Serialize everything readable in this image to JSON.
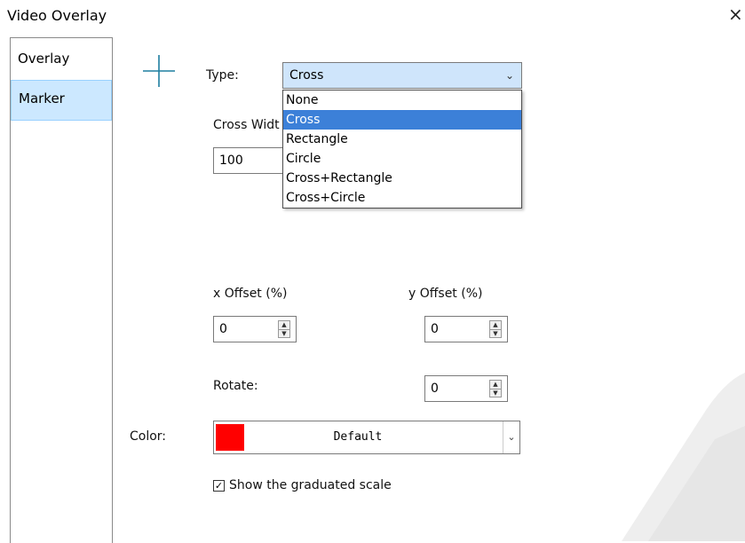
{
  "window": {
    "title": "Video Overlay",
    "close_label": "×"
  },
  "nav": {
    "items": [
      {
        "label": "Overlay"
      },
      {
        "label": "Marker"
      }
    ]
  },
  "marker": {
    "type_label": "Type:",
    "type_value": "Cross",
    "type_options": [
      "None",
      "Cross",
      "Rectangle",
      "Circle",
      "Cross+Rectangle",
      "Cross+Circle"
    ],
    "cross_width_label": "Cross Widt",
    "cross_width_value": "100",
    "x_offset_label": "x Offset (%)",
    "x_offset_value": "0",
    "y_offset_label": "y Offset (%)",
    "y_offset_value": "0",
    "rotate_label": "Rotate:",
    "rotate_value": "0",
    "color_label": "Color:",
    "color_value": "Default",
    "color_swatch": "#ff0000",
    "show_scale_label": "Show the graduated scale",
    "show_scale_checked": true
  },
  "colors": {
    "selection_bg": "#cce8ff",
    "dropdown_highlight": "#3c80d8",
    "icon": "#1e7fa0"
  },
  "icons": {
    "marker_preview": "cross-icon",
    "dropdown_arrow": "chevron-down-icon"
  }
}
